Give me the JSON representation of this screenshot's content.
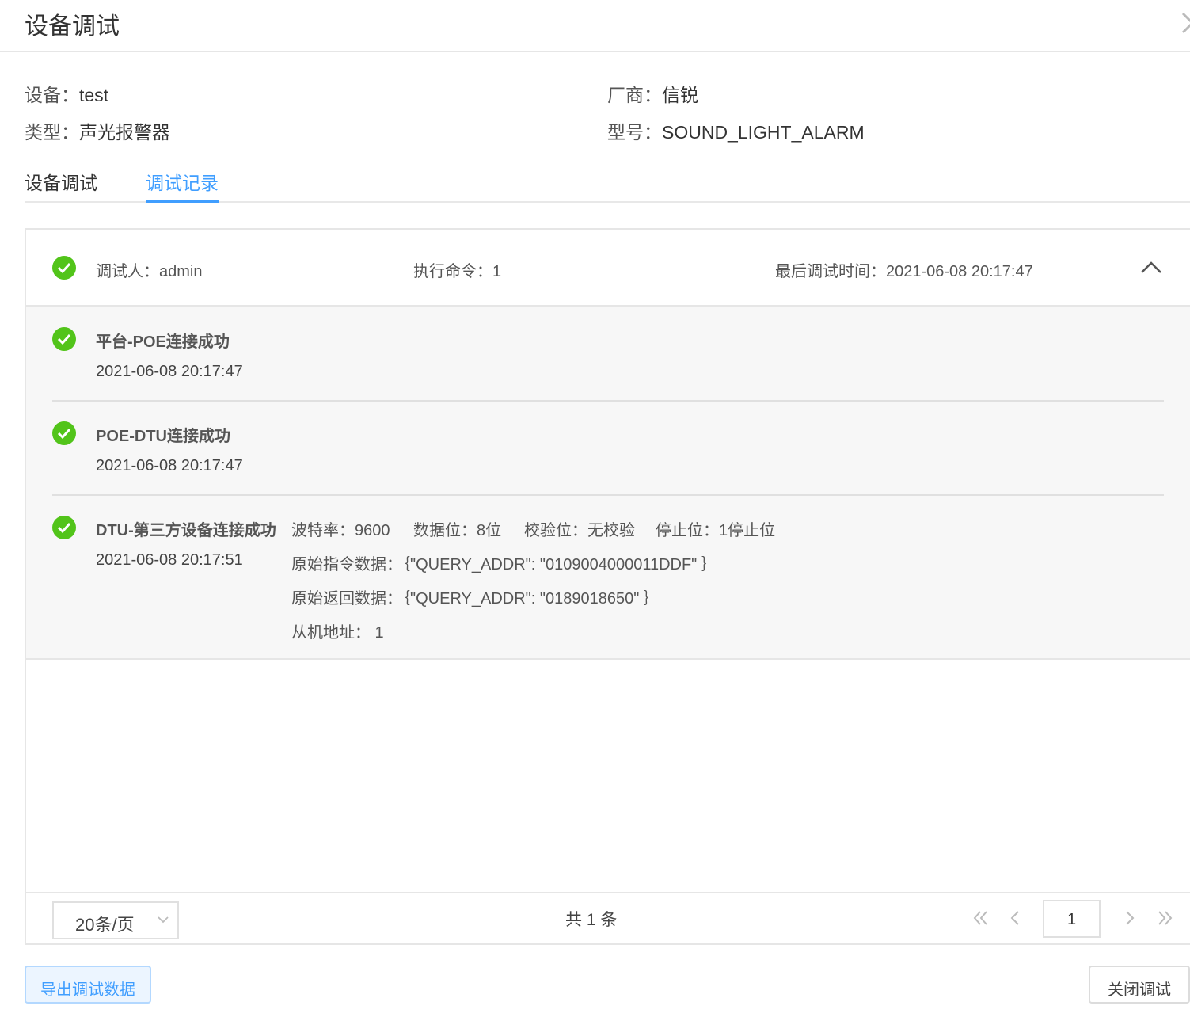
{
  "header": {
    "title": "设备调试"
  },
  "device": {
    "device_label": "设备：",
    "device_value": "test",
    "vendor_label": "厂商：",
    "vendor_value": "信锐",
    "type_label": "类型：",
    "type_value": "声光报警器",
    "model_label": "型号：",
    "model_value": "SOUND_LIGHT_ALARM"
  },
  "tabs": [
    {
      "label": "设备调试",
      "active": false
    },
    {
      "label": "调试记录",
      "active": true
    }
  ],
  "record": {
    "operator": "调试人：admin",
    "commands": "执行命令：1",
    "last_time": "最后调试时间：2021-06-08 20:17:47",
    "steps": [
      {
        "title": "平台-POE连接成功",
        "time": "2021-06-08 20:17:47"
      },
      {
        "title": "POE-DTU连接成功",
        "time": "2021-06-08 20:17:47"
      },
      {
        "title": "DTU-第三方设备连接成功",
        "time": "2021-06-08 20:17:51",
        "baud": "波特率：9600",
        "data_bits": "数据位：8位",
        "parity": "校验位：无校验",
        "stop_bits": "停止位：1停止位",
        "raw_cmd": "原始指令数据：｛\"QUERY_ADDR\": \"0109004000011DDF\" ｝",
        "raw_resp": "原始返回数据：｛\"QUERY_ADDR\": \"0189018650\" ｝",
        "slave_addr": "从机地址：  1"
      }
    ]
  },
  "pager": {
    "page_size": "20条/页",
    "total": "共 1 条",
    "current_page": "1"
  },
  "buttons": {
    "export": "导出调试数据",
    "close": "关闭调试"
  },
  "colors": {
    "accent": "#409eff",
    "success": "#52c41a"
  }
}
